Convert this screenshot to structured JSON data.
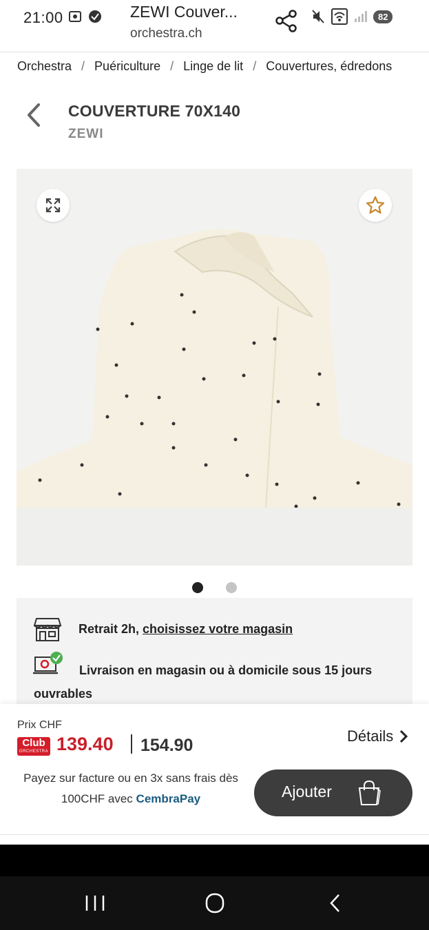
{
  "status_bar": {
    "time": "21:00",
    "battery": "82"
  },
  "browser": {
    "page_title": "ZEWI Couver...",
    "host": "orchestra.ch"
  },
  "breadcrumb": [
    "Orchestra",
    "Puériculture",
    "Linge de lit",
    "Couvertures, édredons"
  ],
  "breadcrumb_separator": "/",
  "product": {
    "title": "COUVERTURE 70X140",
    "brand": "ZEWI",
    "image_count": 2,
    "active_image": 1
  },
  "info": {
    "pickup_prefix": "Retrait 2h, ",
    "pickup_link": "choisissez votre magasin",
    "delivery": "Livraison en magasin ou à domicile sous 15 jours ouvrables"
  },
  "price": {
    "label": "Prix CHF",
    "club_badge_top": "Club",
    "club_badge_bottom": "ORCHESTRA",
    "club_price": "139.40",
    "regular_price": "154.90",
    "details": "Détails",
    "payment_prefix": "Payez sur facture ou en 3x sans frais dès 100CHF avec ",
    "payment_brand": "CembraPay",
    "add_button": "Ajouter"
  },
  "colors": {
    "club_red": "#d51d2a",
    "button_dark": "#3d3d3d",
    "cembrapay_blue": "#1a5b80"
  },
  "icons": {
    "share": "share-icon",
    "back": "chevron-left-icon",
    "expand": "expand-icon",
    "favorite": "star-icon",
    "store": "store-icon",
    "delivery": "laptop-check-icon",
    "details": "chevron-right-icon",
    "cart": "shopping-bag-icon"
  }
}
